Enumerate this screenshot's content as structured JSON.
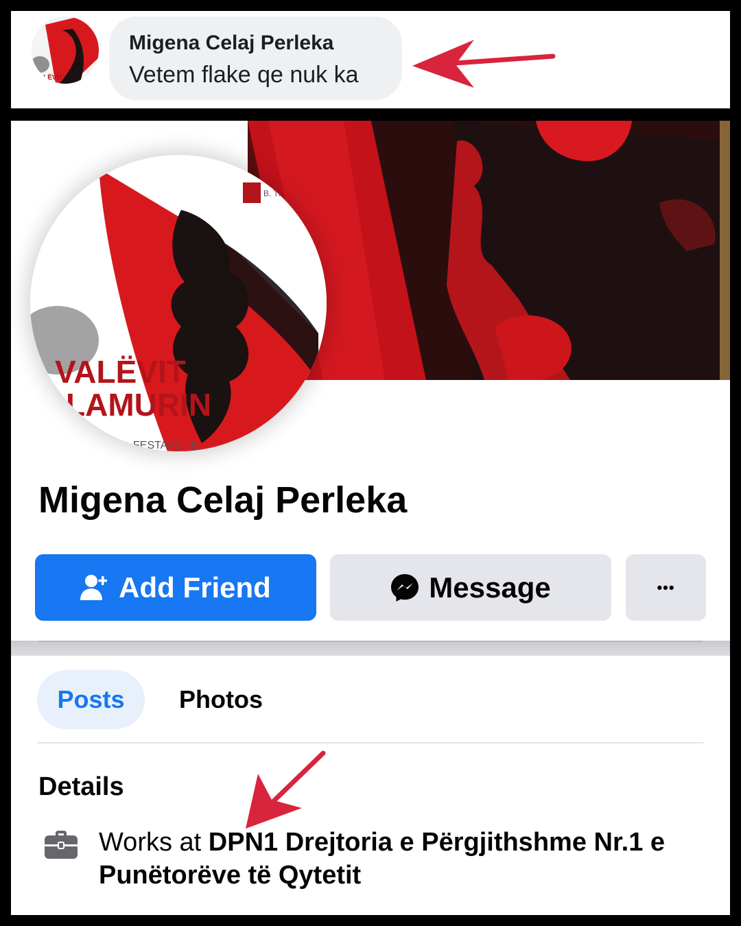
{
  "comment": {
    "author": "Migena Celaj Perleka",
    "text": "Vetem flake qe nuk ka"
  },
  "profile": {
    "name": "Migena Celaj Perleka",
    "picture_caption_line1": "VALËVIT",
    "picture_caption_line2": "LAMURIN",
    "picture_caption_small": "FESTAVE TË",
    "picture_logo_text": "B. TIR."
  },
  "actions": {
    "add_friend_label": "Add Friend",
    "message_label": "Message",
    "more_label": "•••"
  },
  "tabs": [
    {
      "label": "Posts",
      "active": true
    },
    {
      "label": "Photos",
      "active": false
    }
  ],
  "details": {
    "heading": "Details",
    "work_prefix": "Works at ",
    "work_place": "DPN1 Drejtoria e Përgjithshme Nr.1 e Punëtorëve të Qytetit"
  },
  "colors": {
    "brand_blue": "#1877f2",
    "annotation_arrow": "#d8243c",
    "flag_red": "#d7191e",
    "flag_black": "#1a1111"
  },
  "icons": {
    "add_friend": "person-add-icon",
    "message": "messenger-icon",
    "work": "briefcase-icon"
  }
}
